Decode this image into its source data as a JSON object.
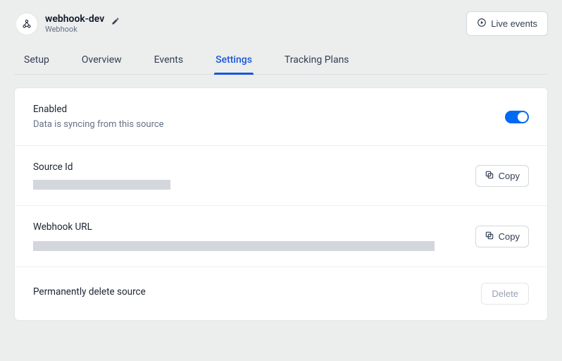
{
  "header": {
    "title": "webhook-dev",
    "subtitle": "Webhook",
    "live_events_label": "Live events"
  },
  "tabs": [
    {
      "label": "Setup"
    },
    {
      "label": "Overview"
    },
    {
      "label": "Events"
    },
    {
      "label": "Settings",
      "active": true
    },
    {
      "label": "Tracking Plans"
    }
  ],
  "sections": {
    "enabled": {
      "label": "Enabled",
      "description": "Data is syncing from this source",
      "on": true
    },
    "source_id": {
      "label": "Source Id",
      "copy_label": "Copy"
    },
    "webhook_url": {
      "label": "Webhook URL",
      "copy_label": "Copy"
    },
    "delete": {
      "label": "Permanently delete source",
      "button_label": "Delete"
    }
  }
}
